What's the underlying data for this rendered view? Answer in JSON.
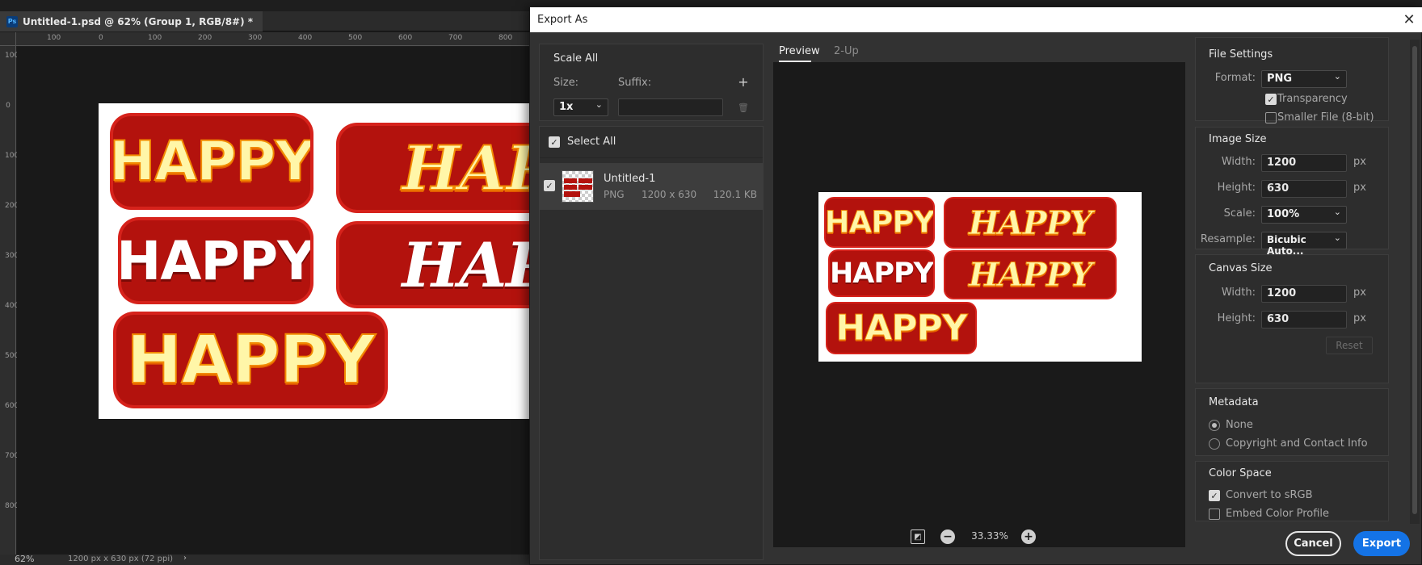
{
  "ps": {
    "doc_tab": "Untitled-1.psd @ 62% (Group 1, RGB/8#) *",
    "ps_logo": "Ps",
    "ruler_top": [
      "100",
      "0",
      "100",
      "200",
      "300",
      "400",
      "500",
      "600",
      "700",
      "800"
    ],
    "ruler_left": [
      "100",
      "0",
      "100",
      "200",
      "300",
      "400",
      "500",
      "600",
      "700",
      "800"
    ],
    "status_zoom": "62%",
    "status_info": "1200 px x 630 px (72 ppi)",
    "sticker_text": "HAPPY",
    "sticker_text_clipped": "HAP"
  },
  "dialog": {
    "title": "Export As",
    "close_glyph": "✕",
    "scale": {
      "title": "Scale All",
      "size_label": "Size:",
      "suffix_label": "Suffix:",
      "size_value": "1x",
      "suffix_value": "",
      "add_glyph": "+",
      "delete_glyph": "🗑"
    },
    "select_all_label": "Select All",
    "asset": {
      "name": "Untitled-1",
      "format": "PNG",
      "dimensions": "1200 x 630",
      "filesize": "120.1 KB"
    },
    "tabs": {
      "preview": "Preview",
      "two_up": "2-Up"
    },
    "zoom_level": "33.33%",
    "file_settings": {
      "title": "File Settings",
      "format_label": "Format:",
      "format_value": "PNG",
      "transparency_label": "Transparency",
      "smaller_file_label": "Smaller File (8-bit)"
    },
    "image_size": {
      "title": "Image Size",
      "width_label": "Width:",
      "width_value": "1200",
      "height_label": "Height:",
      "height_value": "630",
      "scale_label": "Scale:",
      "scale_value": "100%",
      "resample_label": "Resample:",
      "resample_value": "Bicubic Auto...",
      "unit": "px"
    },
    "canvas_size": {
      "title": "Canvas Size",
      "width_label": "Width:",
      "width_value": "1200",
      "height_label": "Height:",
      "height_value": "630",
      "unit": "px",
      "reset_label": "Reset"
    },
    "metadata": {
      "title": "Metadata",
      "none_label": "None",
      "copyright_label": "Copyright and Contact Info"
    },
    "color_space": {
      "title": "Color Space",
      "convert_label": "Convert to sRGB",
      "embed_label": "Embed Color Profile"
    },
    "buttons": {
      "cancel": "Cancel",
      "export": "Export"
    }
  },
  "colors": {
    "accent": "#1473e6",
    "sticker_red": "#b3120d",
    "sticker_yellow": "#fff6a8"
  }
}
